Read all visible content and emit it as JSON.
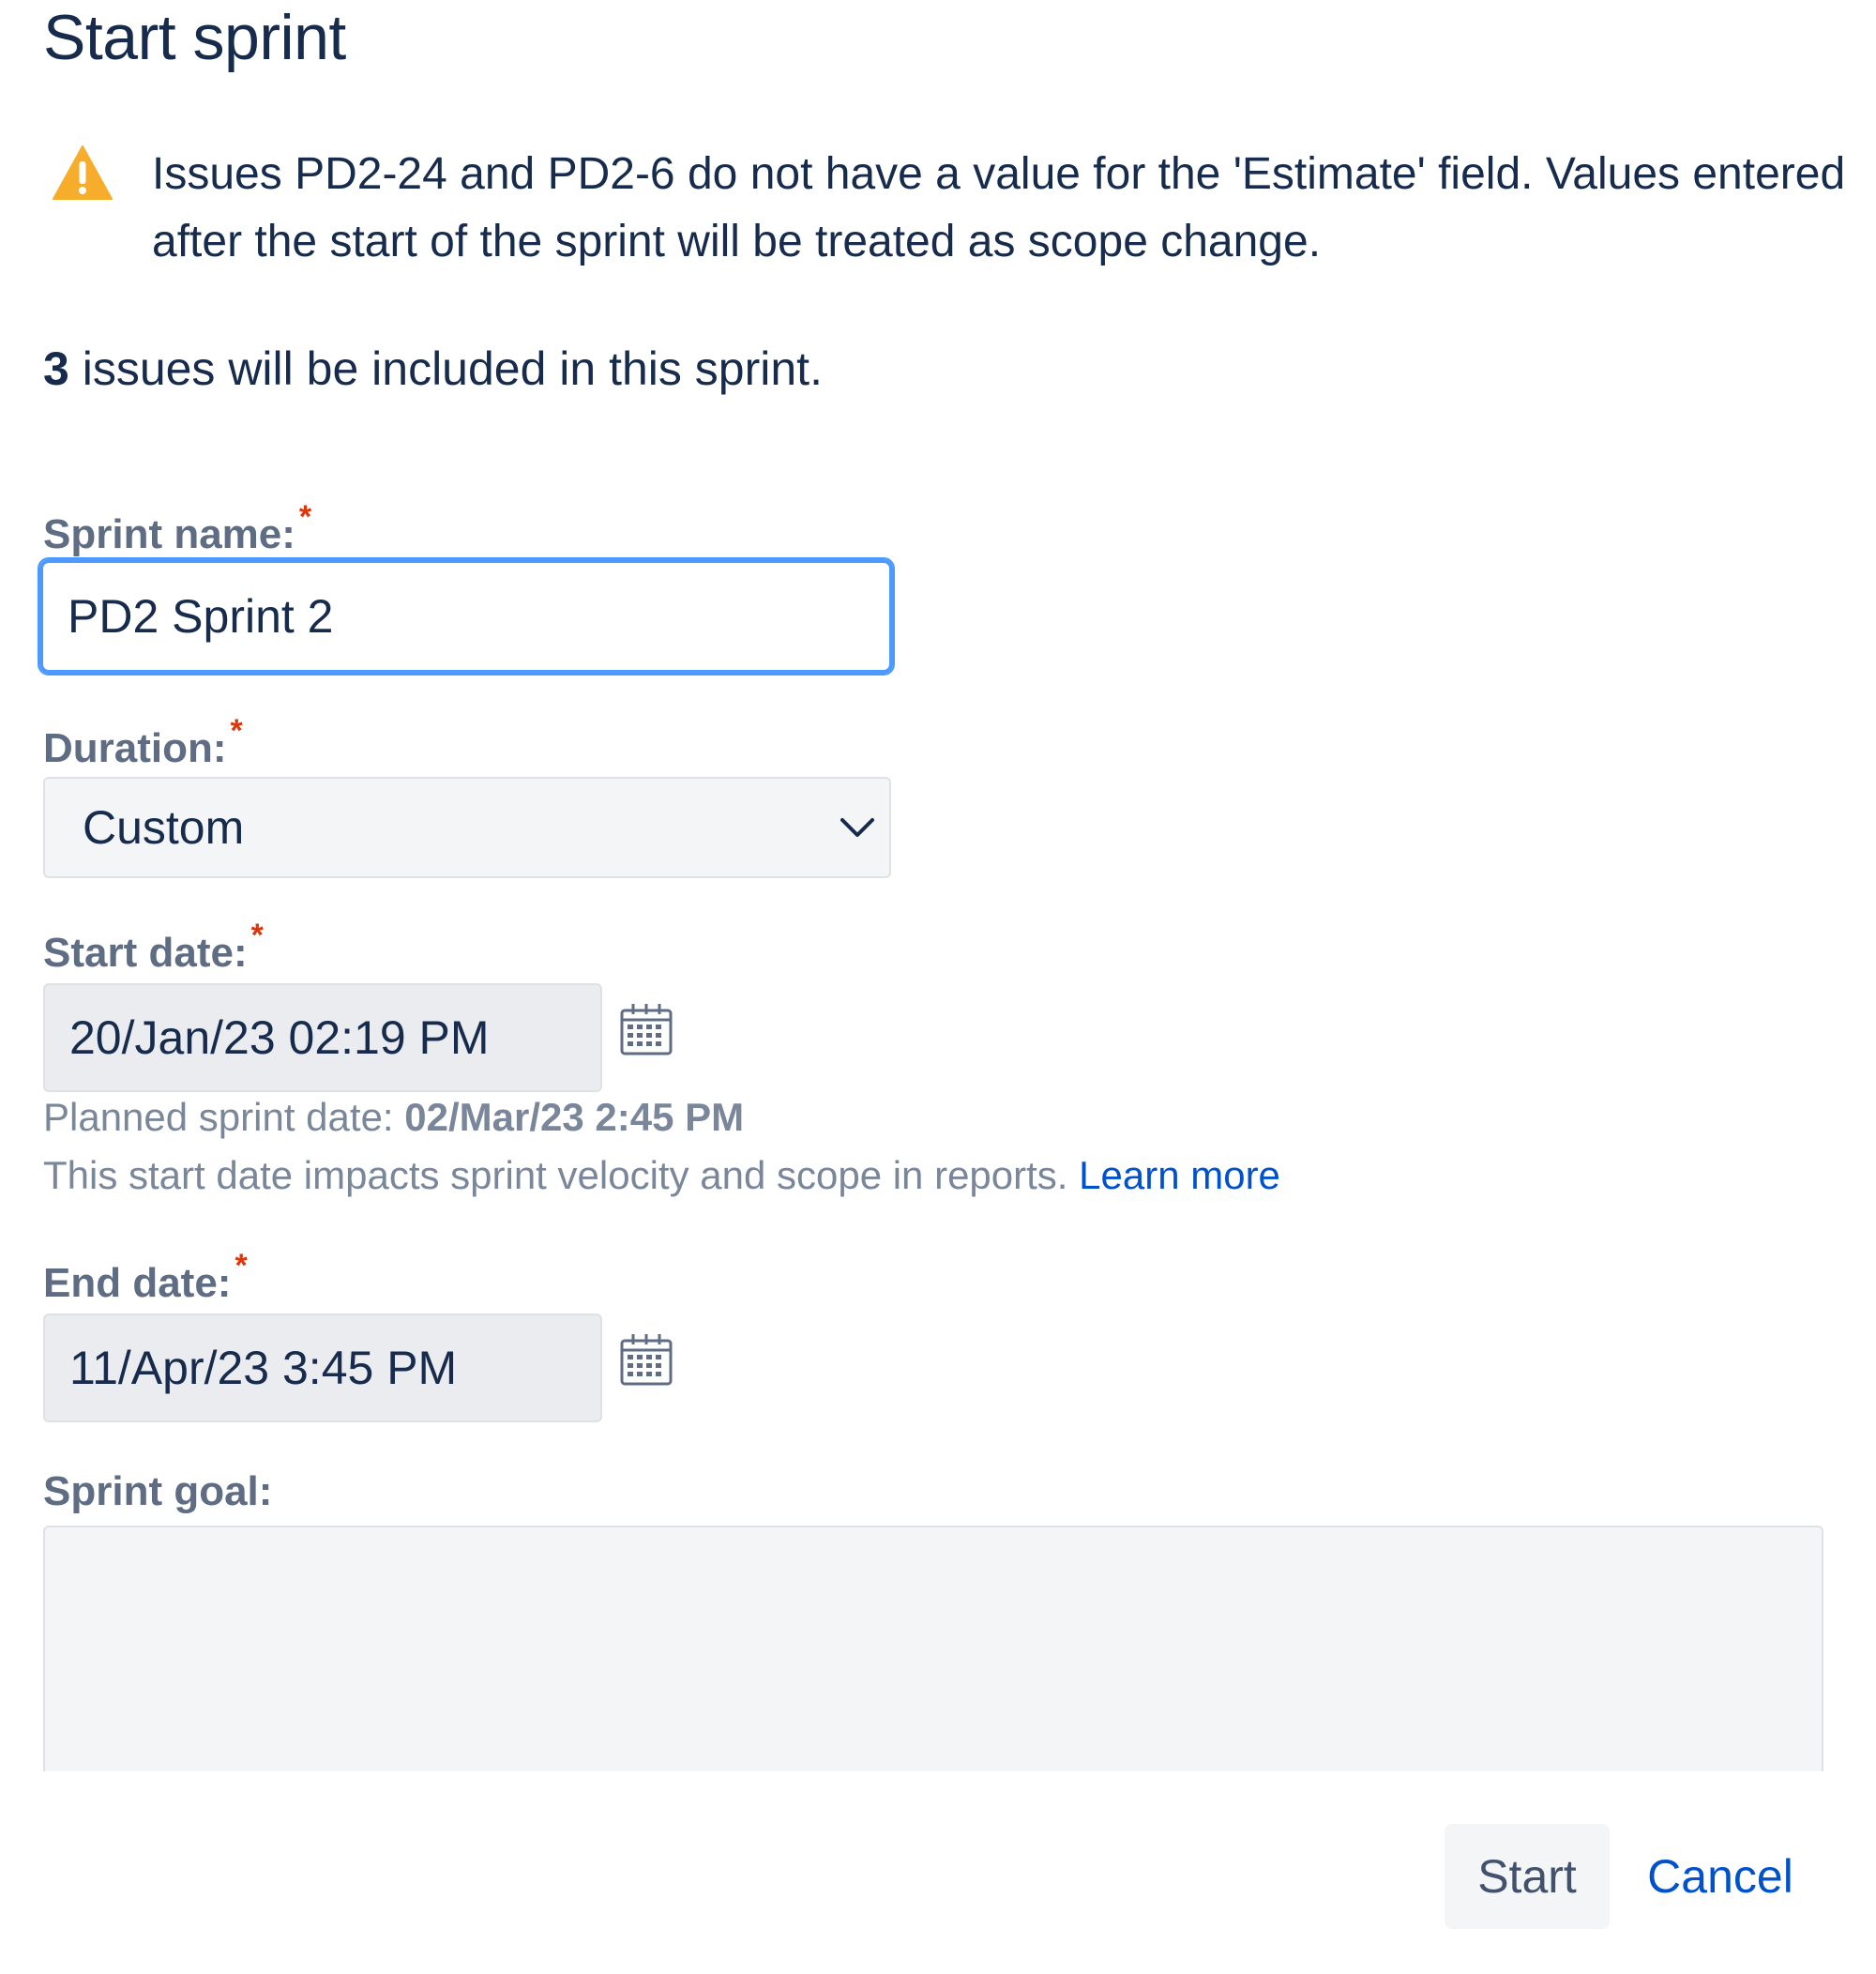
{
  "dialog": {
    "title": "Start sprint"
  },
  "warning": {
    "icon": "warning-triangle-icon",
    "icon_color": "#f6ad2b",
    "text": "Issues PD2-24 and PD2-6 do not have a value for the 'Estimate' field. Values entered after the start of the sprint will be treated as scope change."
  },
  "summary": {
    "count": "3",
    "text": " issues will be included in this sprint."
  },
  "form": {
    "required_marker": "*",
    "sprint_name": {
      "label": "Sprint name:",
      "value": "PD2 Sprint 2"
    },
    "duration": {
      "label": "Duration:",
      "value": "Custom",
      "icon": "chevron-down-icon"
    },
    "start_date": {
      "label": "Start date:",
      "value": "20/Jan/23 02:19 PM",
      "icon": "calendar-icon",
      "planned_label": "Planned sprint date: ",
      "planned_value": "02/Mar/23 2:45 PM",
      "impact_text": "This start date impacts sprint velocity and scope in reports. ",
      "learn_more": "Learn more"
    },
    "end_date": {
      "label": "End date:",
      "value": "11/Apr/23 3:45 PM",
      "icon": "calendar-icon"
    },
    "sprint_goal": {
      "label": "Sprint goal:",
      "value": ""
    }
  },
  "actions": {
    "start_label": "Start",
    "cancel_label": "Cancel"
  },
  "colors": {
    "text": "#172b4d",
    "label": "#5e6c84",
    "required": "#de350b",
    "focus_border": "#4c9aff",
    "link": "#0052cc",
    "muted": "#7a869a"
  }
}
